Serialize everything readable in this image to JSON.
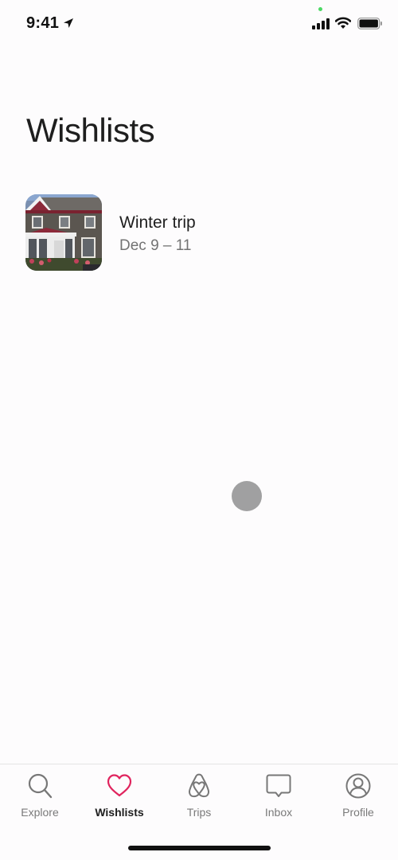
{
  "status_bar": {
    "time": "9:41",
    "icons": [
      "location-arrow-icon",
      "cellular-signal-icon",
      "wifi-icon",
      "battery-icon"
    ]
  },
  "page": {
    "title": "Wishlists"
  },
  "wishlists": [
    {
      "title": "Winter trip",
      "dates": "Dec 9 – 11",
      "thumbnail": "house-photo"
    }
  ],
  "tab_bar": {
    "active_color": "#e0245e",
    "tabs": [
      {
        "label": "Explore",
        "icon": "search-icon",
        "active": false
      },
      {
        "label": "Wishlists",
        "icon": "heart-icon",
        "active": true
      },
      {
        "label": "Trips",
        "icon": "airbnb-logo-icon",
        "active": false
      },
      {
        "label": "Inbox",
        "icon": "chat-bubble-icon",
        "active": false
      },
      {
        "label": "Profile",
        "icon": "profile-icon",
        "active": false
      }
    ]
  }
}
